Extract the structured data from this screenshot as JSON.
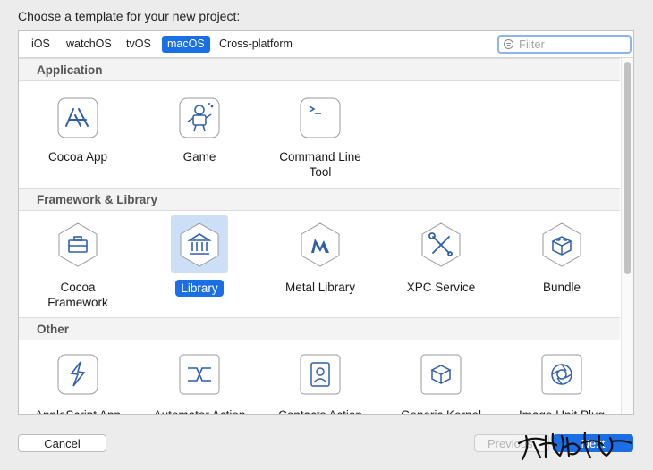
{
  "heading": "Choose a template for your new project:",
  "tabs": [
    {
      "label": "iOS",
      "active": false
    },
    {
      "label": "watchOS",
      "active": false
    },
    {
      "label": "tvOS",
      "active": false
    },
    {
      "label": "macOS",
      "active": true
    },
    {
      "label": "Cross-platform",
      "active": false
    }
  ],
  "filter": {
    "placeholder": "Filter",
    "icon": "filter-icon"
  },
  "sections": [
    {
      "title": "Application",
      "items": [
        {
          "label": "Cocoa App",
          "icon": "app-store-icon"
        },
        {
          "label": "Game",
          "icon": "game-robot-icon"
        },
        {
          "label": "Command Line Tool",
          "icon": "terminal-icon"
        }
      ]
    },
    {
      "title": "Framework & Library",
      "items": [
        {
          "label": "Cocoa Framework",
          "icon": "toolbox-icon"
        },
        {
          "label": "Library",
          "icon": "library-building-icon",
          "selected": true
        },
        {
          "label": "Metal Library",
          "icon": "metal-icon"
        },
        {
          "label": "XPC Service",
          "icon": "tools-icon"
        },
        {
          "label": "Bundle",
          "icon": "lego-brick-icon"
        }
      ]
    },
    {
      "title": "Other",
      "items": [
        {
          "label": "AppleScript App",
          "icon": "applescript-icon"
        },
        {
          "label": "Automator Action",
          "icon": "automator-icon"
        },
        {
          "label": "Contacts Action",
          "icon": "contacts-icon"
        },
        {
          "label": "Generic Kernel",
          "icon": "kernel-brick-icon"
        },
        {
          "label": "Image Unit Plug",
          "icon": "aperture-icon"
        }
      ]
    }
  ],
  "buttons": {
    "cancel": "Cancel",
    "previous": "Previous",
    "next": "Next"
  },
  "colors": {
    "accent": "#1a6ee6",
    "selection": "#cddff7",
    "icon_stroke": "#2f5fae"
  }
}
